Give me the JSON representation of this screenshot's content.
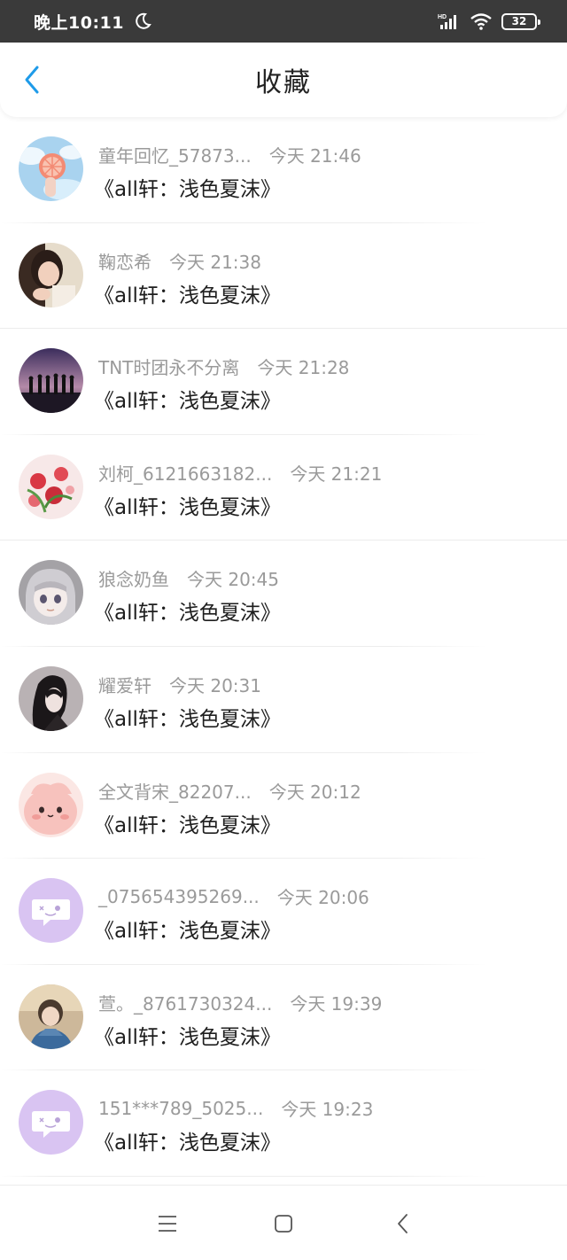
{
  "status_bar": {
    "time": "晚上10:11",
    "battery": "32",
    "network_label": "HD"
  },
  "header": {
    "title": "收藏"
  },
  "items": [
    {
      "user": "童年回忆_57873...",
      "time": "今天 21:46",
      "title": "《all轩：浅色夏沫》",
      "avatar_style": "grapefruit-sky"
    },
    {
      "user": "鞠恋希",
      "time": "今天 21:38",
      "title": "《all轩：浅色夏沫》",
      "avatar_style": "girl-photo"
    },
    {
      "user": "TNT时团永不分离",
      "time": "今天 21:28",
      "title": "《all轩：浅色夏沫》",
      "avatar_style": "silhouettes-sunset"
    },
    {
      "user": "刘柯_6121663182...",
      "time": "今天 21:21",
      "title": "《all轩：浅色夏沫》",
      "avatar_style": "flowers"
    },
    {
      "user": "狼念奶鱼",
      "time": "今天 20:45",
      "title": "《all轩：浅色夏沫》",
      "avatar_style": "anime-gray"
    },
    {
      "user": "耀爱轩",
      "time": "今天 20:31",
      "title": "《all轩：浅色夏沫》",
      "avatar_style": "anime-dark"
    },
    {
      "user": "全文背宋_82207...",
      "time": "今天 20:12",
      "title": "《all轩：浅色夏沫》",
      "avatar_style": "pink-cartoon"
    },
    {
      "user": "_075654395269...",
      "time": "今天 20:06",
      "title": "《all轩：浅色夏沫》",
      "avatar_style": "default-purple"
    },
    {
      "user": "萱。_8761730324...",
      "time": "今天 19:39",
      "title": "《all轩：浅色夏沫》",
      "avatar_style": "girl-hoodie"
    },
    {
      "user": "151***789_5025...",
      "time": "今天 19:23",
      "title": "《all轩：浅色夏沫》",
      "avatar_style": "default-purple"
    }
  ],
  "colors": {
    "accent": "#1e9be9",
    "status_bar_bg": "#3a3a3a",
    "meta_text": "#9a9a9a",
    "title_text": "#1e1e1e",
    "default_avatar": "#d9c4f2"
  }
}
